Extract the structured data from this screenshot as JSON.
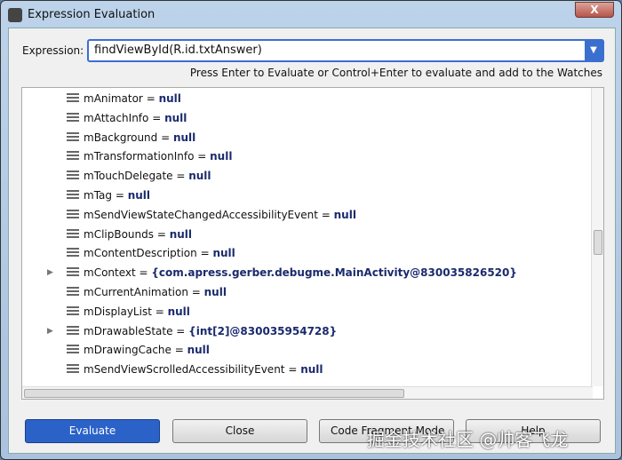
{
  "window": {
    "title": "Expression Evaluation",
    "close_label": "X"
  },
  "expression": {
    "label": "Expression:",
    "value": "findViewById(R.id.txtAnswer)",
    "hint": "Press Enter to Evaluate or Control+Enter to evaluate and add to the Watches"
  },
  "tree": [
    {
      "name": "mAnimator",
      "value": "null"
    },
    {
      "name": "mAttachInfo",
      "value": "null"
    },
    {
      "name": "mBackground",
      "value": "null"
    },
    {
      "name": "mTransformationInfo",
      "value": "null"
    },
    {
      "name": "mTouchDelegate",
      "value": "null"
    },
    {
      "name": "mTag",
      "value": "null"
    },
    {
      "name": "mSendViewStateChangedAccessibilityEvent",
      "value": "null"
    },
    {
      "name": "mClipBounds",
      "value": "null"
    },
    {
      "name": "mContentDescription",
      "value": "null"
    },
    {
      "name": "mContext",
      "value": "{com.apress.gerber.debugme.MainActivity@830035826520}"
    },
    {
      "name": "mCurrentAnimation",
      "value": "null"
    },
    {
      "name": "mDisplayList",
      "value": "null"
    },
    {
      "name": "mDrawableState",
      "value": "{int[2]@830035954728}"
    },
    {
      "name": "mDrawingCache",
      "value": "null"
    },
    {
      "name": "mSendViewScrolledAccessibilityEvent",
      "value": "null"
    }
  ],
  "buttons": {
    "evaluate": "Evaluate",
    "close": "Close",
    "code_fragment": "Code Fragment Mode",
    "help": "Help"
  },
  "watermark": "掘金技术社区 @帅客飞龙"
}
